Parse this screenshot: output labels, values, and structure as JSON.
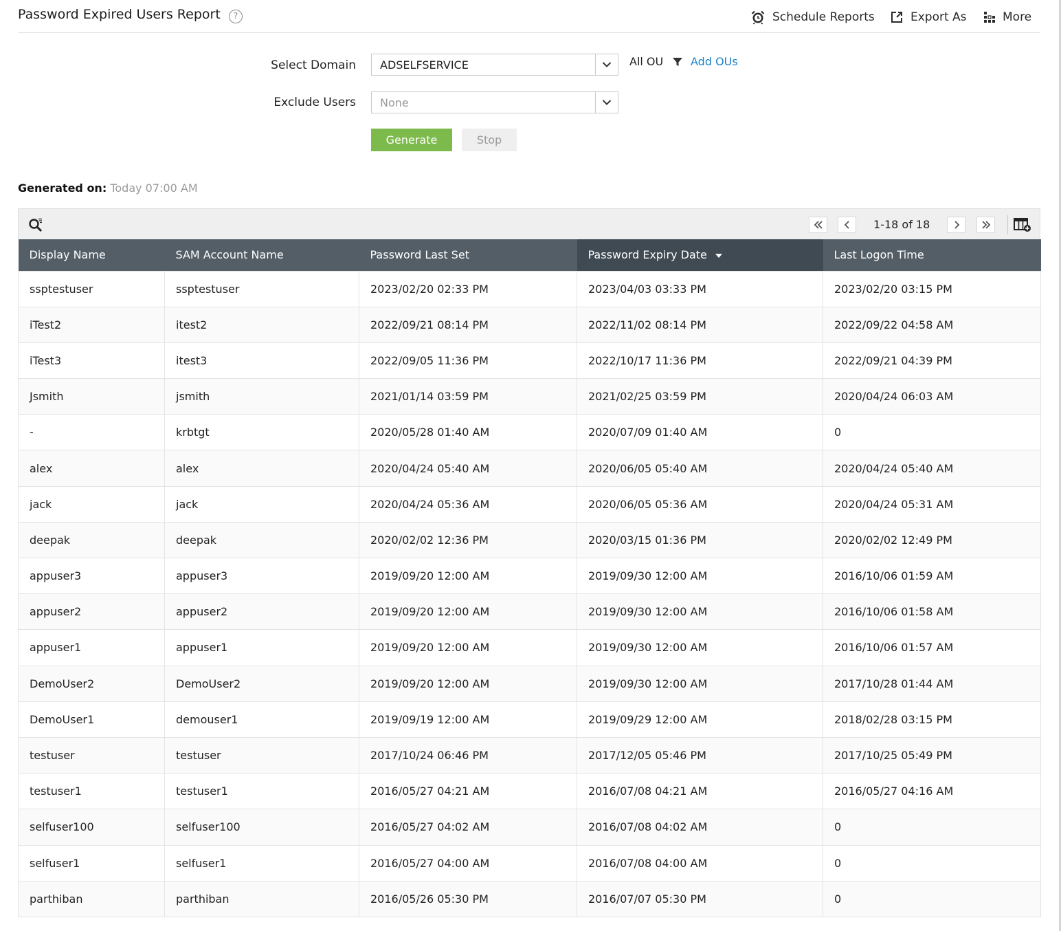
{
  "header": {
    "title": "Password Expired Users Report",
    "help": "?",
    "actions": {
      "schedule": "Schedule Reports",
      "export": "Export As",
      "more": "More"
    }
  },
  "form": {
    "domain_label": "Select Domain",
    "domain_value": "ADSELFSERVICE",
    "exclude_label": "Exclude Users",
    "exclude_value": "None",
    "all_ou": "All OU",
    "add_ous": "Add OUs",
    "generate": "Generate",
    "stop": "Stop"
  },
  "generated": {
    "label": "Generated on:",
    "value": "Today 07:00 AM"
  },
  "pagination": {
    "range": "1-18 of 18"
  },
  "colors": {
    "header_bg": "#545e66",
    "sorted_header_bg": "#3f4a52",
    "generate_bg": "#7cba4b",
    "link": "#1a82c8"
  },
  "table": {
    "columns": [
      "Display Name",
      "SAM Account Name",
      "Password Last Set",
      "Password Expiry Date",
      "Last Logon Time"
    ],
    "sorted_column": 3,
    "rows": [
      [
        "ssptestuser",
        "ssptestuser",
        "2023/02/20 02:33 PM",
        "2023/04/03 03:33 PM",
        "2023/02/20 03:15 PM"
      ],
      [
        "iTest2",
        "itest2",
        "2022/09/21 08:14 PM",
        "2022/11/02 08:14 PM",
        "2022/09/22 04:58 AM"
      ],
      [
        "iTest3",
        "itest3",
        "2022/09/05 11:36 PM",
        "2022/10/17 11:36 PM",
        "2022/09/21 04:39 PM"
      ],
      [
        "Jsmith",
        "jsmith",
        "2021/01/14 03:59 PM",
        "2021/02/25 03:59 PM",
        "2020/04/24 06:03 AM"
      ],
      [
        "-",
        "krbtgt",
        "2020/05/28 01:40 AM",
        "2020/07/09 01:40 AM",
        "0"
      ],
      [
        "alex",
        "alex",
        "2020/04/24 05:40 AM",
        "2020/06/05 05:40 AM",
        "2020/04/24 05:40 AM"
      ],
      [
        "jack",
        "jack",
        "2020/04/24 05:36 AM",
        "2020/06/05 05:36 AM",
        "2020/04/24 05:31 AM"
      ],
      [
        "deepak",
        "deepak",
        "2020/02/02 12:36 PM",
        "2020/03/15 01:36 PM",
        "2020/02/02 12:49 PM"
      ],
      [
        "appuser3",
        "appuser3",
        "2019/09/20 12:00 AM",
        "2019/09/30 12:00 AM",
        "2016/10/06 01:59 AM"
      ],
      [
        "appuser2",
        "appuser2",
        "2019/09/20 12:00 AM",
        "2019/09/30 12:00 AM",
        "2016/10/06 01:58 AM"
      ],
      [
        "appuser1",
        "appuser1",
        "2019/09/20 12:00 AM",
        "2019/09/30 12:00 AM",
        "2016/10/06 01:57 AM"
      ],
      [
        "DemoUser2",
        "DemoUser2",
        "2019/09/20 12:00 AM",
        "2019/09/30 12:00 AM",
        "2017/10/28 01:44 AM"
      ],
      [
        "DemoUser1",
        "demouser1",
        "2019/09/19 12:00 AM",
        "2019/09/29 12:00 AM",
        "2018/02/28 03:15 PM"
      ],
      [
        "testuser",
        "testuser",
        "2017/10/24 06:46 PM",
        "2017/12/05 05:46 PM",
        "2017/10/25 05:49 PM"
      ],
      [
        "testuser1",
        "testuser1",
        "2016/05/27 04:21 AM",
        "2016/07/08 04:21 AM",
        "2016/05/27 04:16 AM"
      ],
      [
        "selfuser100",
        "selfuser100",
        "2016/05/27 04:02 AM",
        "2016/07/08 04:02 AM",
        "0"
      ],
      [
        "selfuser1",
        "selfuser1",
        "2016/05/27 04:00 AM",
        "2016/07/08 04:00 AM",
        "0"
      ],
      [
        "parthiban",
        "parthiban",
        "2016/05/26 05:30 PM",
        "2016/07/07 05:30 PM",
        "0"
      ]
    ]
  }
}
